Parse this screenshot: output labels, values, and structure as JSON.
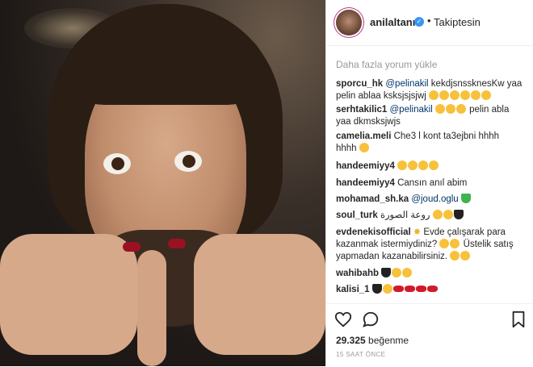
{
  "post": {
    "username": "anilaltann",
    "verified_badge": "✓",
    "separator": "•",
    "follow_status": "Takiptesin",
    "avatar_icon": "profile-avatar"
  },
  "comments": {
    "load_more": "Daha fazla yorum yükle",
    "items": [
      {
        "user": "sporcu_hk",
        "mention": "@pelinakil",
        "text1": " kekdjsnssknesKw yaa",
        "text2": "pelin ablaa ksksjsjsjwj"
      },
      {
        "user": "serhtakilic1",
        "mention": "@pelinakil",
        "text1": " pelin abla",
        "text2": "yaa dkmsksjwjs"
      },
      {
        "user": "camelia.meli",
        "text1": "Che3 l kont ta3ejbni hhhh",
        "text2": "hhhh"
      },
      {
        "user": "handeemiyy4",
        "text1": ""
      },
      {
        "user": "handeemiyy4",
        "text1": "Cansın anıl abim"
      },
      {
        "user": "mohamad_sh.ka",
        "mention": "@joud.oglu",
        "text1": ""
      },
      {
        "user": "soul_turk",
        "text1": "روعة الصورة"
      },
      {
        "user": "evdenekisofficial",
        "text1": "Evde çalışarak para",
        "text2": "kazanmak istermiydiniz?",
        "text2b": "Üstelik satış",
        "text3": "yapmadan kazanabilirsiniz."
      },
      {
        "user": "wahibahb",
        "text1": ""
      },
      {
        "user": "kalisi_1",
        "text1": ""
      }
    ]
  },
  "stats": {
    "likes_count": "29.325",
    "likes_label": "beğenme",
    "time_ago": "15 SAAT ÖNCE"
  },
  "colors": {
    "link": "#003569",
    "verified": "#3897f0",
    "muted": "#999999"
  }
}
